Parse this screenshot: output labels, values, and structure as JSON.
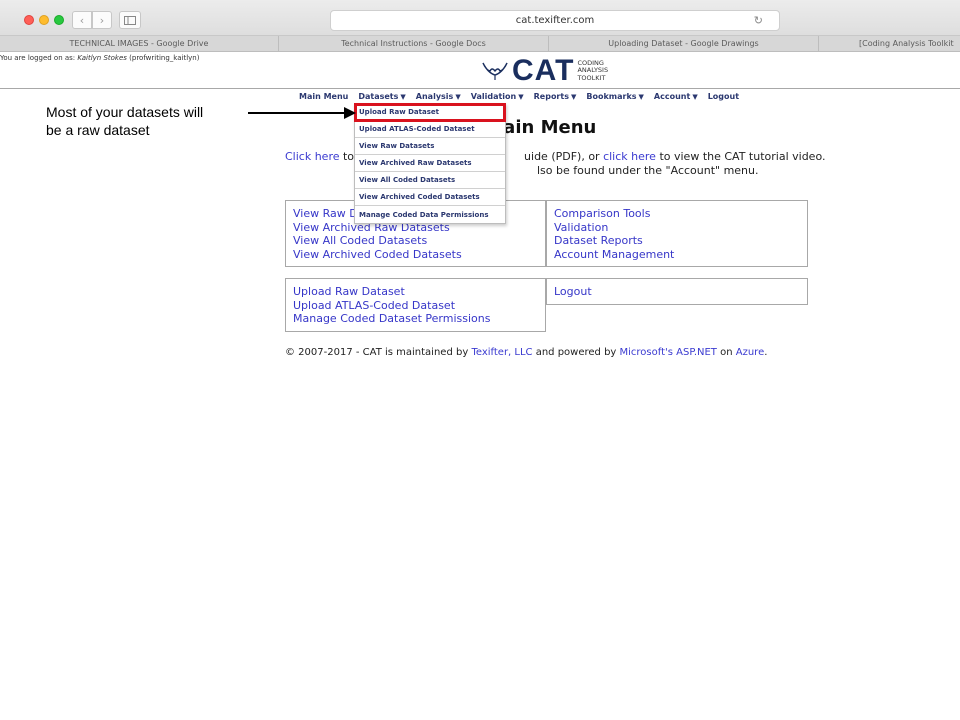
{
  "browser": {
    "url": "cat.texifter.com",
    "tabs": [
      "TECHNICAL IMAGES - Google Drive",
      "Technical Instructions - Google Docs",
      "Uploading Dataset - Google Drawings",
      "[Coding Analysis Toolkit"
    ],
    "accent": "#d9121e"
  },
  "session": {
    "prefix": "You are logged on as: ",
    "user": "Kaitlyn Stokes",
    "account": " (profwriting_kaitlyn)"
  },
  "logo": {
    "text": "CAT",
    "sub1": "CODING",
    "sub2": "ANALYSIS",
    "sub3": "TOOLKIT"
  },
  "menu": {
    "main": "Main Menu",
    "datasets": "Datasets",
    "analysis": "Analysis",
    "validation": "Validation",
    "reports": "Reports",
    "bookmarks": "Bookmarks",
    "account": "Account",
    "logout": "Logout"
  },
  "dropdown": [
    "Upload Raw Dataset",
    "Upload ATLAS-Coded Dataset",
    "View Raw Datasets",
    "View Archived Raw Datasets",
    "View All Coded Datasets",
    "View Archived Coded Datasets",
    "Manage Coded Data Permissions"
  ],
  "annotation": {
    "line1": "Most of your datasets will",
    "line2": "be a raw dataset"
  },
  "page": {
    "heading": "lain Menu",
    "intro1_link": "Click here",
    "intro1_a": " to",
    "intro1_b": "uide (PDF), or ",
    "intro1_link2": "click here",
    "intro1_c": " to view the CAT tutorial video.",
    "intro2": "lso be found under the \"Account\" menu."
  },
  "boxes": {
    "box1": [
      "View Raw D",
      "View Archived Raw Datasets",
      "View All Coded Datasets",
      "View Archived Coded Datasets"
    ],
    "box2": [
      "Comparison Tools",
      "Validation",
      "Dataset Reports",
      "Account Management"
    ],
    "box3": [
      "Upload Raw Dataset",
      "Upload ATLAS-Coded Dataset",
      "Manage Coded Dataset Permissions"
    ],
    "box4": [
      "Logout"
    ]
  },
  "footer": {
    "a": "© 2007-2017 - CAT is maintained by ",
    "texifter": "Texifter, LLC",
    "b": " and powered by ",
    "aspnet": "Microsoft's ASP.NET",
    "c": " on ",
    "azure": "Azure",
    "d": "."
  }
}
